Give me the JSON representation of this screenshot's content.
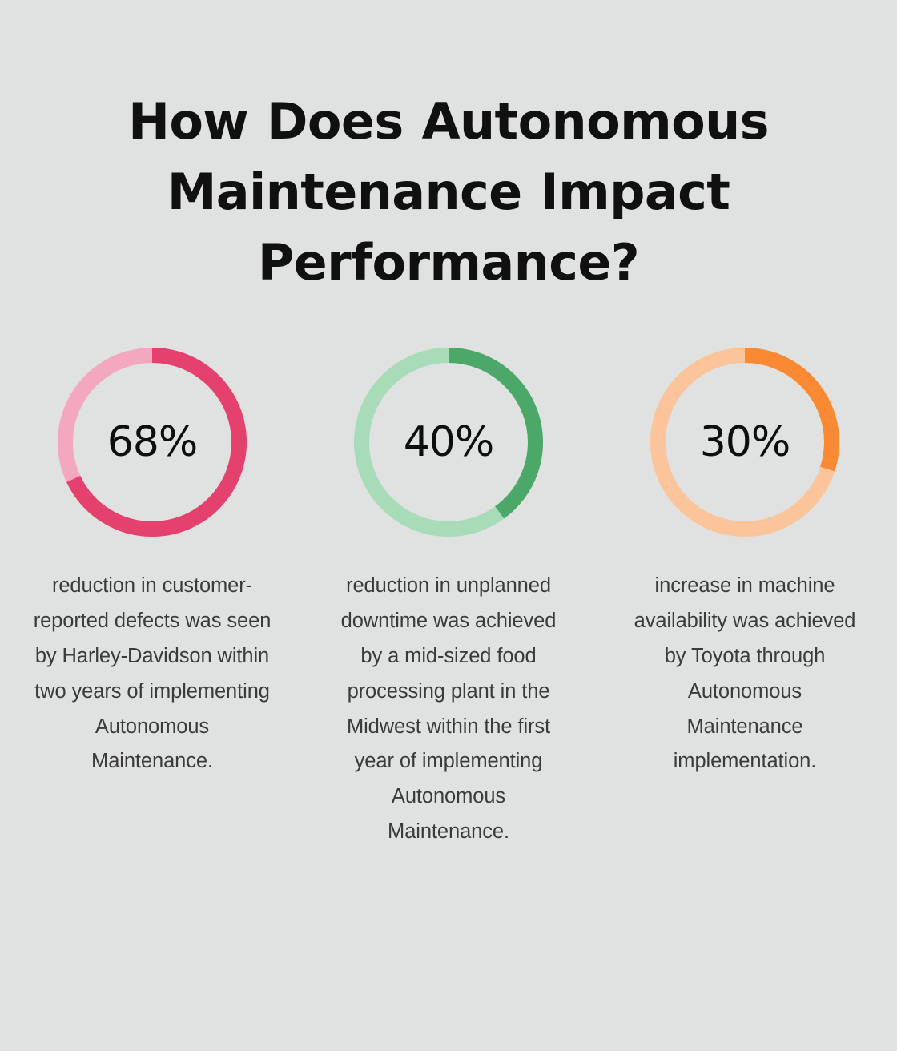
{
  "background_color": "#e0e1e1",
  "header": {
    "title": "How Does Autonomous Maintenance Impact Performance?"
  },
  "chart_data": {
    "type": "pie",
    "title": "How Does Autonomous Maintenance Impact Performance?",
    "subtitle": "",
    "xlabel": "",
    "ylabel": "",
    "legend_position": "none",
    "grid": false,
    "chart_variant": "donut-gauge-set",
    "categories": [
      "reduction in customer-reported defects (Harley-Davidson)",
      "reduction in unplanned downtime (Midwest food processing plant)",
      "increase in machine availability (Toyota)"
    ],
    "values": [
      68,
      40,
      30
    ],
    "value_labels": [
      "68%",
      "40%",
      "30%"
    ],
    "units": "percent",
    "ylim": [
      0,
      100
    ],
    "series": [
      {
        "name": "Autonomous Maintenance impact",
        "values": [
          68,
          40,
          30
        ]
      }
    ],
    "remainders": [
      32,
      60,
      70
    ],
    "start_angle_deg": 0,
    "direction": "clockwise"
  },
  "stats": [
    {
      "id": "harley-davidson-defect-reduction",
      "percent_label": "68%",
      "percent_value": 68,
      "remainder_value": 32,
      "color_value": "#e5416e",
      "color_track": "#f4a8c0",
      "caption": "reduction in customer-reported defects was seen by Harley-Davidson within two years of implementing Autonomous Maintenance."
    },
    {
      "id": "food-plant-downtime-reduction",
      "percent_label": "40%",
      "percent_value": 40,
      "remainder_value": 60,
      "color_value": "#4ca868",
      "color_track": "#a8dcb8",
      "caption": "reduction in unplanned downtime was achieved by a mid-sized food processing plant in the Midwest within the first year of implementing Autonomous Maintenance."
    },
    {
      "id": "toyota-machine-availability",
      "percent_label": "30%",
      "percent_value": 30,
      "remainder_value": 70,
      "color_value": "#f98a33",
      "color_track": "#fbc49a",
      "caption": "increase in machine availability was achieved by Toyota through Autonomous Maintenance implementation."
    }
  ]
}
